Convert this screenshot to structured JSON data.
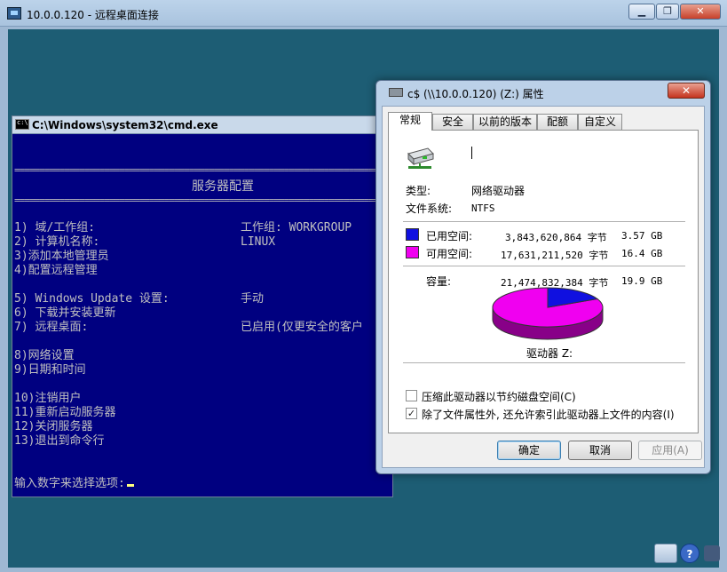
{
  "rdp": {
    "title": "10.0.0.120 - 远程桌面连接",
    "minimize": "▁",
    "restore": "❐",
    "close": "✕"
  },
  "cmd": {
    "title": "C:\\Windows\\system32\\cmd.exe",
    "rule": "===============================================================================",
    "heading": "服务器配置",
    "lines": [
      "1) 域/工作组:",
      "2) 计算机名称:",
      "3)添加本地管理员",
      "4)配置远程管理",
      "5) Windows Update 设置:",
      "6) 下载并安装更新",
      "7) 远程桌面:",
      "8)网络设置",
      "9)日期和时间",
      "10)注销用户",
      "11)重新启动服务器",
      "12)关闭服务器",
      "13)退出到命令行"
    ],
    "values": {
      "workgroup": "工作组:  WORKGROUP",
      "computer_name": "LINUX",
      "windows_update": "手动",
      "remote_desktop": "已启用(仅更安全的客户"
    },
    "prompt": "输入数字来选择选项:"
  },
  "dialog": {
    "title": "c$ (\\\\10.0.0.120) (Z:) 属性",
    "close": "✕",
    "tabs": [
      "常规",
      "安全",
      "以前的版本",
      "配额",
      "自定义"
    ],
    "type_label": "类型:",
    "type_value": "网络驱动器",
    "fs_label": "文件系统:",
    "fs_value": "NTFS",
    "used_label": "已用空间:",
    "used_bytes": "3,843,620,864 字节",
    "used_gb": "3.57 GB",
    "free_label": "可用空间:",
    "free_bytes": "17,631,211,520 字节",
    "free_gb": "16.4 GB",
    "capacity_label": "容量:",
    "capacity_bytes": "21,474,832,384 字节",
    "capacity_gb": "19.9 GB",
    "drive_label": "驱动器 Z:",
    "compress_label": "压缩此驱动器以节约磁盘空间(C)",
    "compress_checked": false,
    "index_label": "除了文件属性外, 还允许索引此驱动器上文件的内容(I)",
    "index_checked": true,
    "ok": "确定",
    "cancel": "取消",
    "apply": "应用(A)",
    "colors": {
      "used": "#1010e0",
      "free": "#f000f0",
      "used_side": "#000080",
      "free_side": "#880088"
    },
    "used_fraction": 0.179
  },
  "tray": {
    "help": "?"
  }
}
